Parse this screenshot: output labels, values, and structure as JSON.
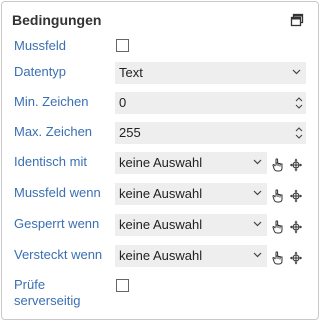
{
  "panel": {
    "title": "Bedingungen",
    "restore_icon": "window-restore-icon"
  },
  "rows": {
    "mussfeld": {
      "label": "Mussfeld",
      "checked": false
    },
    "datentyp": {
      "label": "Datentyp",
      "value": "Text"
    },
    "min_zeichen": {
      "label": "Min. Zeichen",
      "value": "0"
    },
    "max_zeichen": {
      "label": "Max. Zeichen",
      "value": "255"
    },
    "identisch_mit": {
      "label": "Identisch mit",
      "value": "keine Auswahl"
    },
    "mussfeld_wenn": {
      "label": "Mussfeld wenn",
      "value": "keine Auswahl"
    },
    "gesperrt_wenn": {
      "label": "Gesperrt wenn",
      "value": "keine Auswahl"
    },
    "versteckt_wenn": {
      "label": "Versteckt wenn",
      "value": "keine Auswahl"
    },
    "pruefe_serverseitig": {
      "label_line1": "Prüfe",
      "label_line2": "serverseitig",
      "checked": false
    }
  },
  "icons": {
    "pointer": "hand-pointer-icon",
    "target": "crosshair-icon",
    "chevron": "chevron-down-icon",
    "spinner": "up-down-spinner-icon"
  },
  "colors": {
    "label": "#3a6fb3",
    "field_bg": "#eeeeee",
    "border": "#c9c9c9"
  }
}
